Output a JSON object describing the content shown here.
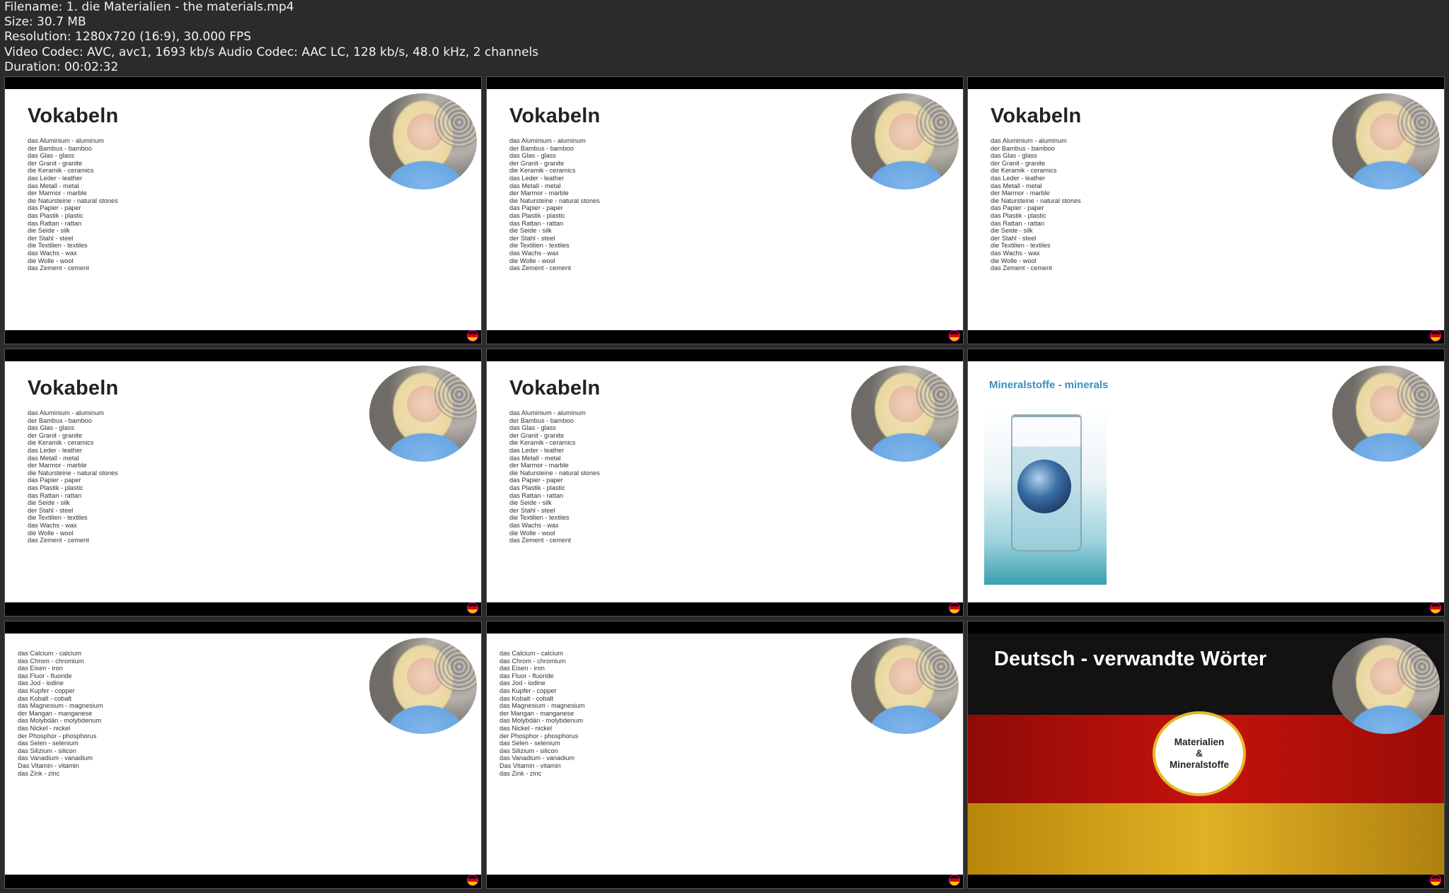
{
  "meta": {
    "filename": "Filename: 1. die Materialien - the materials.mp4",
    "size": "Size: 30.7 MB",
    "resolution": "Resolution: 1280x720 (16:9), 30.000 FPS",
    "codec": "Video Codec: AVC, avc1, 1693 kb/s Audio Codec: AAC LC, 128 kb/s, 48.0 kHz, 2 channels",
    "duration": "Duration: 00:02:32"
  },
  "vocab_title": "Vokabeln",
  "vocab": [
    "das Aluminium - aluminum",
    "der Bambus - bamboo",
    "das Glas - glass",
    "der Granit - granite",
    "die Keramik - ceramics",
    "das Leder - leather",
    "das Metall - metal",
    "der Marmor - marble",
    "die Natursteine - natural stones",
    "das Papier - paper",
    "das Plastik - plastic",
    "das Rattan - rattan",
    "die Seide - silk",
    "der Stahl - steel",
    "die Textilien - textiles",
    "das Wachs - wax",
    "die Wolle - wool",
    "das Zement - cement"
  ],
  "mineral_title": "Mineralstoffe - minerals",
  "minerals": [
    "das Calcium - calcium",
    "das Chrom - chromium",
    "das Eisen - iron",
    "das Fluor - fluoride",
    "das Jod - iodine",
    "das Kupfer - copper",
    "das Kobalt - cobalt",
    "das Magnesium - magnesium",
    "der Mangan - manganese",
    "das Molybdän - molybdenum",
    "das Nickel - nickel",
    "der Phosphor - phosphorus",
    "das Selen - selenium",
    "das Silizium - silicon",
    "das Vanadium - vanadium",
    "Das Vitamin - vitamin",
    "das Zink - zinc"
  ],
  "flag_slide": {
    "title": "Deutsch - verwandte Wörter",
    "line1": "Materialien",
    "line2": "&",
    "line3": "Mineralstoffe"
  }
}
